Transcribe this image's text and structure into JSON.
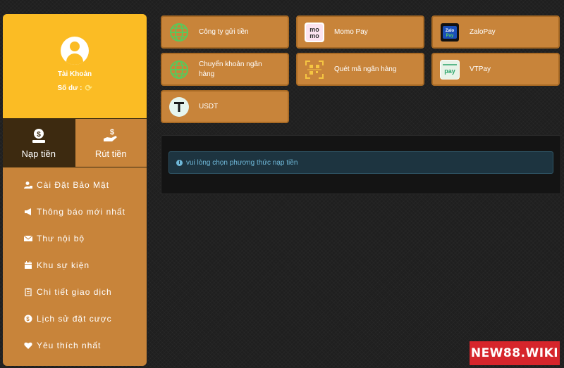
{
  "profile": {
    "name": "Tài Khoản",
    "balance_label": "Số dư :"
  },
  "actions": [
    {
      "label": "Nạp tiền",
      "active": true
    },
    {
      "label": "Rút tiền",
      "active": false
    }
  ],
  "menu": [
    {
      "label": "Cài Đặt Bảo Mật",
      "icon": "user-lock-icon"
    },
    {
      "label": "Thông báo mới nhất",
      "icon": "megaphone-icon"
    },
    {
      "label": "Thư nội bộ",
      "icon": "envelope-icon"
    },
    {
      "label": "Khu sự kiện",
      "icon": "calendar-icon"
    },
    {
      "label": "Chi tiết giao dịch",
      "icon": "clipboard-icon"
    },
    {
      "label": "Lịch sử đặt cược",
      "icon": "dollar-circle-icon"
    },
    {
      "label": "Yêu thích nhất",
      "icon": "heart-icon"
    }
  ],
  "methods": [
    {
      "label": "Công ty gửi tiền",
      "icon": "globe-icon"
    },
    {
      "label": "Momo Pay",
      "icon": "momo-icon"
    },
    {
      "label": "ZaloPay",
      "icon": "zalopay-icon"
    },
    {
      "label": "Chuyển khoản ngân hàng",
      "icon": "globe-icon"
    },
    {
      "label": "Quét mã ngân hàng",
      "icon": "qr-scan-icon"
    },
    {
      "label": "VTPay",
      "icon": "vtpay-icon"
    },
    {
      "label": "USDT",
      "icon": "tether-icon"
    }
  ],
  "notice": "vui lòng chọn phương thức nạp tiền",
  "watermark": "NEW88.WIKI",
  "logo_text": {
    "momo": [
      "mo",
      "mo"
    ],
    "zalo": [
      "Zalo",
      "Pay"
    ],
    "vtpay": "pay"
  },
  "colors": {
    "accent": "#fbbc24",
    "card": "#c8843a",
    "active": "#3d2a10",
    "notice": "#6fb8d8",
    "watermark": "#d6252b"
  }
}
